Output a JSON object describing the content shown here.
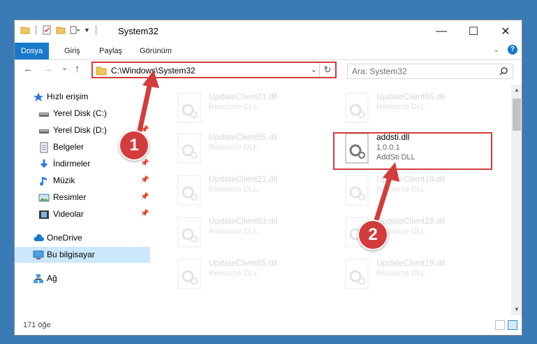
{
  "window": {
    "title": "System32",
    "controls": {
      "minimize": "—",
      "maximize": "☐",
      "close": "✕"
    }
  },
  "ribbon": {
    "tabs": [
      {
        "label": "Dosya",
        "active": true
      },
      {
        "label": "Giriş",
        "active": false
      },
      {
        "label": "Paylaş",
        "active": false
      },
      {
        "label": "Görünüm",
        "active": false
      }
    ],
    "expand_icon": "chevron-down-icon",
    "help_label": "?"
  },
  "navigation": {
    "back": "←",
    "forward": "→",
    "recent": "⌄",
    "up": "↑",
    "address": "C:\\Windows\\System32",
    "address_dropdown": "⌄",
    "refresh": "↻",
    "search_placeholder": "Ara: System32"
  },
  "sidebar": {
    "items": [
      {
        "label": "Hızlı erişim",
        "icon": "star-icon",
        "pinned": false
      },
      {
        "label": "Yerel Disk (C:)",
        "icon": "drive-icon",
        "pinned": false
      },
      {
        "label": "Yerel Disk (D:)",
        "icon": "drive-icon",
        "pinned": true
      },
      {
        "label": "Belgeler",
        "icon": "documents-icon",
        "pinned": true
      },
      {
        "label": "İndirmeler",
        "icon": "download-icon",
        "pinned": true
      },
      {
        "label": "Müzik",
        "icon": "music-icon",
        "pinned": true
      },
      {
        "label": "Resimler",
        "icon": "pictures-icon",
        "pinned": true
      },
      {
        "label": "Videolar",
        "icon": "videos-icon",
        "pinned": true
      },
      {
        "label": "OneDrive",
        "icon": "cloud-icon",
        "pinned": false
      },
      {
        "label": "Bu bilgisayar",
        "icon": "computer-icon",
        "pinned": false,
        "selected": true
      },
      {
        "label": "Ağ",
        "icon": "network-icon",
        "pinned": false
      }
    ],
    "pin_glyph": "📌"
  },
  "files": [
    {
      "name": "UpdateClient21.dll",
      "line1": "Resource DLL",
      "faded": true
    },
    {
      "name": "UpdateClient65.dll",
      "line1": "Resource DLL",
      "faded": true
    },
    {
      "name": "UpdateClient65.dll",
      "line1": "Resource DLL",
      "faded": true
    },
    {
      "name": "addsti.dll",
      "line1": "1.0.0.1",
      "line2": "AddSti DLL",
      "faded": false,
      "highlighted": true
    },
    {
      "name": "UpdateClient21.dll",
      "line1": "Resource DLL",
      "faded": true
    },
    {
      "name": "UpdateClient19.dll",
      "line1": "Resource DLL",
      "faded": true
    },
    {
      "name": "UpdateClient63.dll",
      "line1": "Resource DLL",
      "faded": true
    },
    {
      "name": "UpdateClient19.dll",
      "line1": "Resource DLL",
      "faded": true
    },
    {
      "name": "UpdateClient65.dll",
      "line1": "Resource DLL",
      "faded": true
    },
    {
      "name": "UpdateClient19.dll",
      "line1": "Resource DLL",
      "faded": true
    }
  ],
  "status": {
    "item_count": "171 öğe"
  },
  "annotations": {
    "step1": "1",
    "step2": "2",
    "color": "#d33c3c"
  }
}
